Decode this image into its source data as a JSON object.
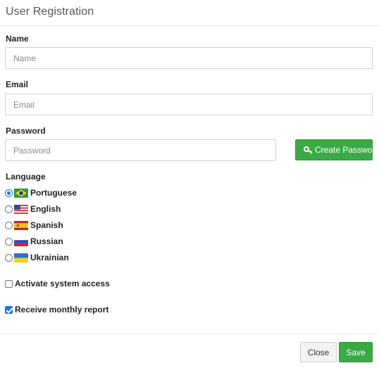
{
  "dialog": {
    "title": "User Registration"
  },
  "form": {
    "name": {
      "label": "Name",
      "placeholder": "Name",
      "value": ""
    },
    "email": {
      "label": "Email",
      "placeholder": "Email",
      "value": ""
    },
    "password": {
      "label": "Password",
      "placeholder": "Password",
      "value": ""
    },
    "create_password_label": "Create Password",
    "create_password_icon": "key-icon",
    "language": {
      "label": "Language",
      "selected": "Portuguese",
      "options": [
        {
          "label": "Portuguese",
          "flag": "brazil-flag-icon"
        },
        {
          "label": "English",
          "flag": "usa-flag-icon"
        },
        {
          "label": "Spanish",
          "flag": "spain-flag-icon"
        },
        {
          "label": "Russian",
          "flag": "russia-flag-icon"
        },
        {
          "label": "Ukrainian",
          "flag": "ukraine-flag-icon"
        }
      ]
    },
    "activate_access": {
      "label": "Activate system access",
      "checked": false
    },
    "monthly_report": {
      "label": "Receive monthly report",
      "checked": true
    }
  },
  "footer": {
    "close_label": "Close",
    "save_label": "Save"
  },
  "colors": {
    "primary_green": "#3aaa45",
    "selected_blue": "#1a73e8"
  }
}
